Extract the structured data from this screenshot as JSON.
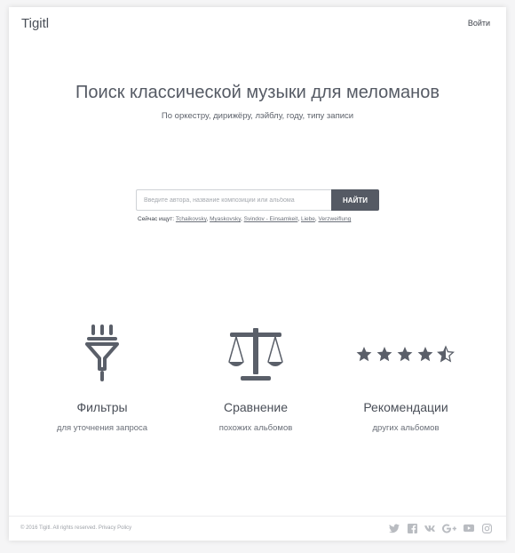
{
  "header": {
    "logo": "Tigitl",
    "login_label": "Войти"
  },
  "hero": {
    "title": "Поиск классической музыки для меломанов",
    "subtitle": "По оркестру, дирижёру, лэйблу, году, типу записи"
  },
  "search": {
    "placeholder": "Введите автора, название композиции или альбома",
    "button_label": "НАЙТИ",
    "trending_label": "Сейчас ищут:",
    "trending": [
      "Tchaikovsky",
      "Myaskovsky",
      "Svindov - Einsamkeit",
      "Liebe",
      "Verzweiflung"
    ]
  },
  "features": [
    {
      "icon": "funnel-icon",
      "name": "Фильтры",
      "desc": "для уточнения запроса"
    },
    {
      "icon": "scales-icon",
      "name": "Сравнение",
      "desc": "похожих альбомов"
    },
    {
      "icon": "rating-stars-icon",
      "name": "Рекомендации",
      "desc": "других альбомов",
      "rating": 4.5
    }
  ],
  "footer": {
    "copyright": "© 2016 Tigitl. All rights reserved.",
    "privacy": "Privacy Policy",
    "social": [
      "twitter-icon",
      "facebook-icon",
      "vk-icon",
      "google-plus-icon",
      "youtube-icon",
      "instagram-icon"
    ]
  },
  "colors": {
    "accent": "#555a64",
    "text": "#4a4f58",
    "icon": "#5a5f69",
    "social": "#b9bcc1"
  }
}
